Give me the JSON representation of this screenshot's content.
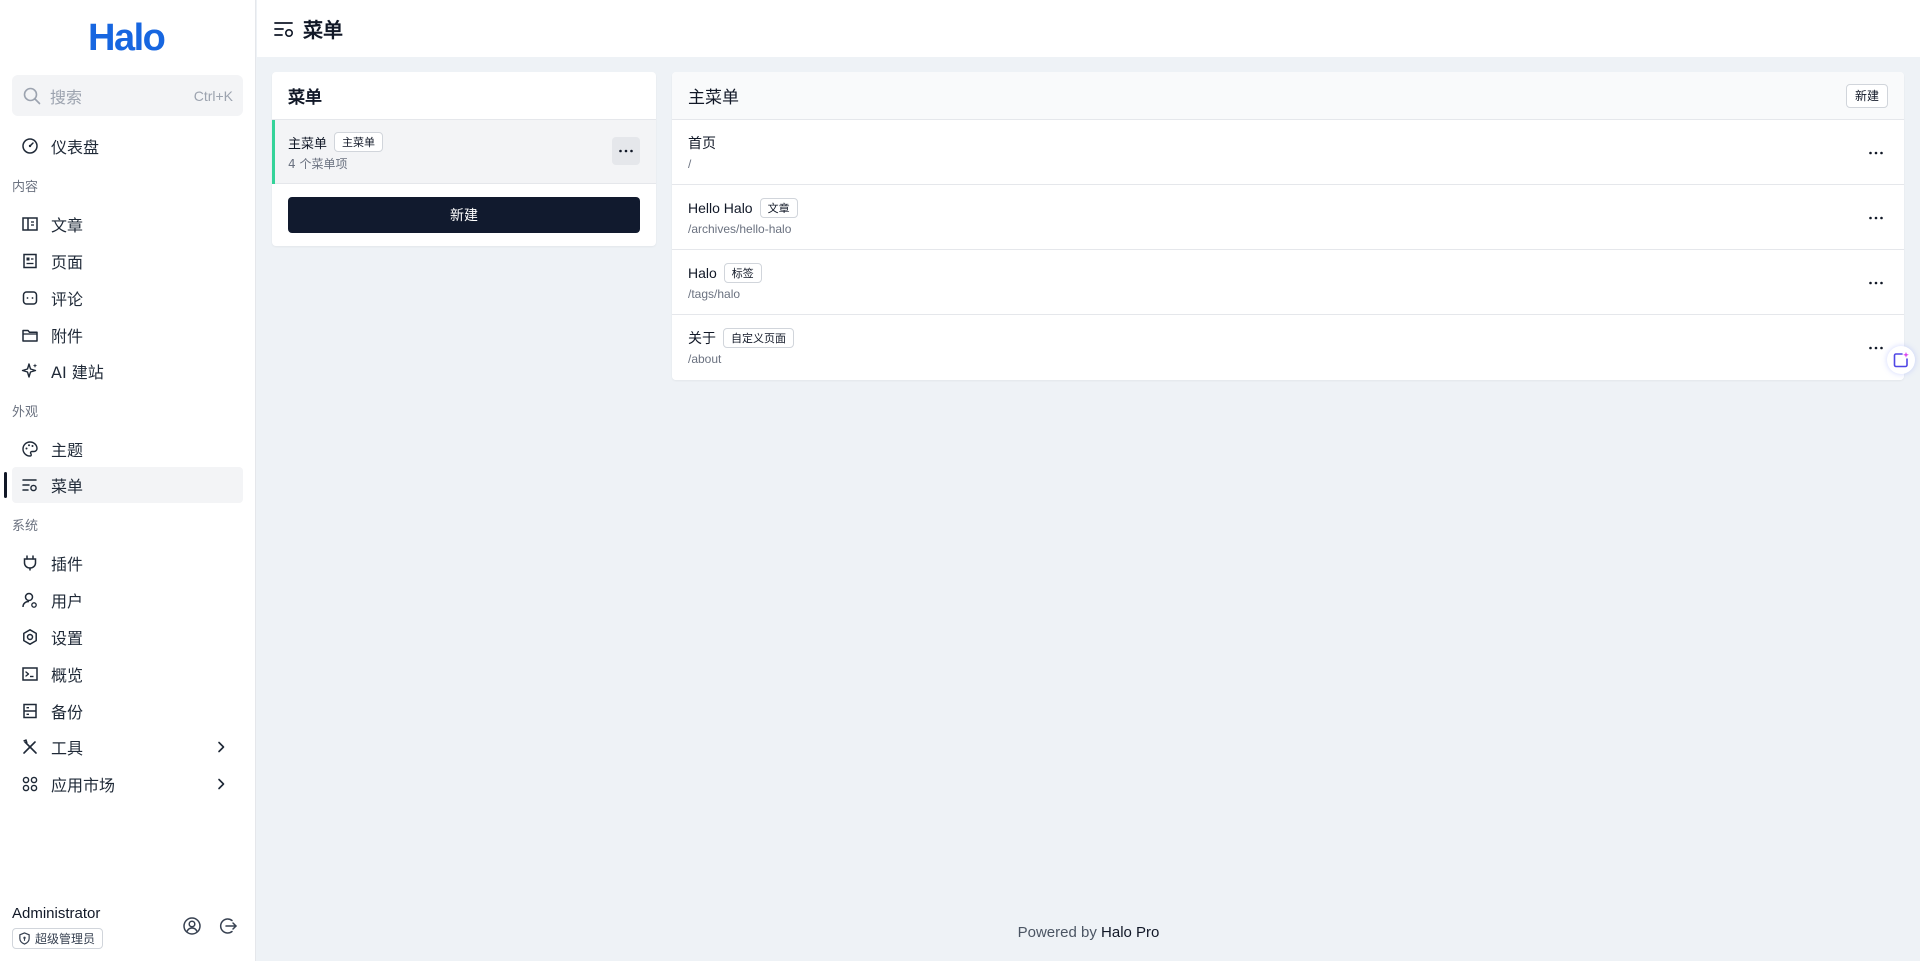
{
  "brand": {
    "logo_text": "Halo",
    "color": "#1766e0"
  },
  "search": {
    "placeholder": "搜索",
    "shortcut": "Ctrl+K"
  },
  "sidebar": {
    "dashboard": "仪表盘",
    "groups": {
      "content": "内容",
      "appearance": "外观",
      "system": "系统"
    },
    "items": {
      "posts": "文章",
      "pages": "页面",
      "comments": "评论",
      "attachments": "附件",
      "ai_site": "AI 建站",
      "themes": "主题",
      "menus": "菜单",
      "plugins": "插件",
      "users": "用户",
      "settings": "设置",
      "overview": "概览",
      "backup": "备份",
      "tools": "工具",
      "app_market": "应用市场"
    },
    "active_item": "menus"
  },
  "user": {
    "name": "Administrator",
    "role": "超级管理员"
  },
  "topbar": {
    "title": "菜单"
  },
  "menus_panel": {
    "title": "菜单",
    "menus": [
      {
        "name": "主菜单",
        "tag": "主菜单",
        "count_text": "4 个菜单项"
      }
    ],
    "new_label": "新建"
  },
  "items_panel": {
    "title": "主菜单",
    "new_label": "新建",
    "items": [
      {
        "name": "首页",
        "tag": "",
        "path": "/"
      },
      {
        "name": "Hello Halo",
        "tag": "文章",
        "path": "/archives/hello-halo"
      },
      {
        "name": "Halo",
        "tag": "标签",
        "path": "/tags/halo"
      },
      {
        "name": "关于",
        "tag": "自定义页面",
        "path": "/about"
      }
    ]
  },
  "footer": {
    "prefix": "Powered by",
    "brand": "Halo Pro"
  },
  "colors": {
    "accent_green": "#34d399",
    "primary_dark": "#111a2e"
  }
}
